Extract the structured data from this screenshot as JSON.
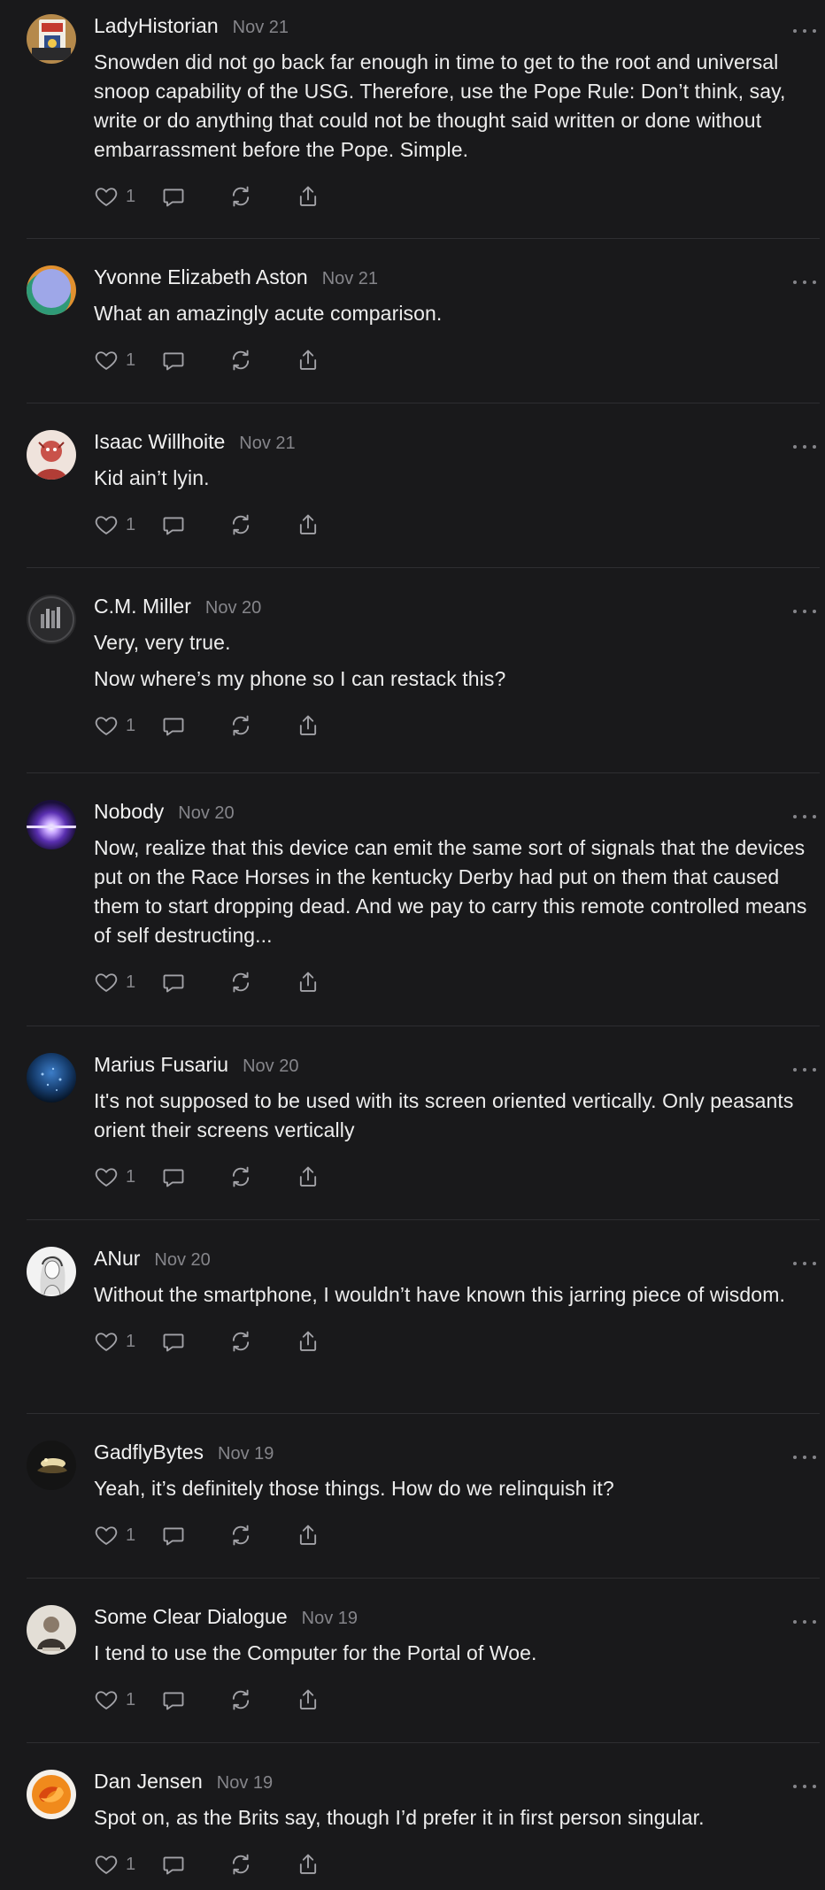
{
  "comments": [
    {
      "author": "LadyHistorian",
      "date": "Nov 21",
      "avatar": "card-icon",
      "paragraphs": [
        "Snowden did not go back far enough in time to get to the root and universal snoop capability of the USG. Therefore, use the Pope Rule: Don’t think, say, write or do anything that could not be thought said written or done without embarrassment before the Pope. Simple."
      ],
      "likes": "1"
    },
    {
      "author": "Yvonne Elizabeth Aston",
      "date": "Nov 21",
      "avatar": "gradient-circle-icon",
      "paragraphs": [
        "What an amazingly acute comparison."
      ],
      "likes": "1"
    },
    {
      "author": "Isaac Willhoite",
      "date": "Nov 21",
      "avatar": "illustration-icon",
      "paragraphs": [
        "Kid ain’t lyin."
      ],
      "likes": "1"
    },
    {
      "author": "C.M. Miller",
      "date": "Nov 20",
      "avatar": "bars-logo-icon",
      "paragraphs": [
        "Very, very true.",
        "Now where’s my phone so I can restack this?"
      ],
      "likes": "1"
    },
    {
      "author": "Nobody",
      "date": "Nov 20",
      "avatar": "light-flare-icon",
      "paragraphs": [
        "Now, realize that this device can emit the same sort of signals that the devices put on the Race Horses in the kentucky Derby had put on them that caused them to start dropping dead. And we pay to carry this remote controlled means of self destructing..."
      ],
      "likes": "1"
    },
    {
      "author": "Marius Fusariu",
      "date": "Nov 20",
      "avatar": "blue-sphere-icon",
      "paragraphs": [
        "It's not supposed to be used with its screen oriented vertically. Only peasants orient their screens vertically"
      ],
      "likes": "1"
    },
    {
      "author": "ANur",
      "date": "Nov 20",
      "avatar": "sketch-portrait-icon",
      "paragraphs": [
        "Without the smartphone, I wouldn’t have known this jarring piece of wisdom."
      ],
      "likes": "1"
    },
    {
      "author": "GadflyBytes",
      "date": "Nov 19",
      "avatar": "dark-photo-icon",
      "paragraphs": [
        "Yeah, it’s definitely those things. How do we relinquish it?"
      ],
      "likes": "1"
    },
    {
      "author": "Some Clear Dialogue",
      "date": "Nov 19",
      "avatar": "portrait-icon",
      "paragraphs": [
        "I tend to use the Computer for the Portal of Woe."
      ],
      "likes": "1"
    },
    {
      "author": "Dan Jensen",
      "date": "Nov 19",
      "avatar": "swirl-logo-icon",
      "paragraphs": [
        "Spot on, as the Brits say, though I’d prefer it in first person singular."
      ],
      "likes": "1"
    }
  ],
  "colors": {
    "background": "#19191b",
    "text": "#ededed",
    "muted": "#85858a",
    "icon": "#a3a3a8",
    "divider": "#2e2e31"
  }
}
